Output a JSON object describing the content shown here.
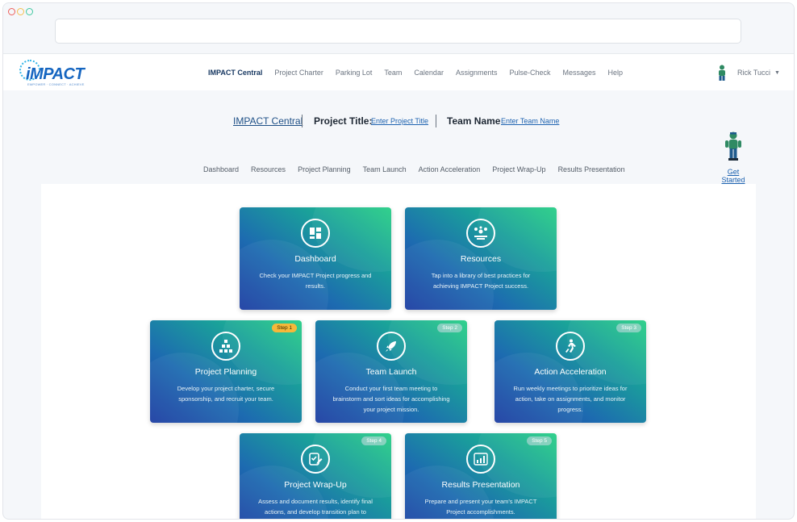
{
  "nav": {
    "logo": "iMPACT",
    "logo_tag": "EMPOWER · CONNECT · ACHIEVE",
    "links": [
      "IMPACT Central",
      "Project Charter",
      "Parking Lot",
      "Team",
      "Calendar",
      "Assignments",
      "Pulse-Check",
      "Messages",
      "Help"
    ],
    "user": "Rick Tucci"
  },
  "titlebar": {
    "central": "IMPACT Central",
    "project_label": "Project Title:",
    "project_link": "Enter Project Title",
    "team_label": "Team Name",
    "team_link": "Enter Team Name"
  },
  "get_started": "Get Started",
  "subnav": [
    "Dashboard",
    "Resources",
    "Project Planning",
    "Team Launch",
    "Action Acceleration",
    "Project Wrap-Up",
    "Results Presentation"
  ],
  "cards": [
    {
      "title": "Dashboard",
      "desc": "Check your IMPACT Project progress and results.",
      "step": "",
      "icon": "dashboard-icon"
    },
    {
      "title": "Resources",
      "desc": "Tap into a library of best practices for achieving IMPACT Project success.",
      "step": "",
      "icon": "resources-icon"
    },
    {
      "title": "Project Planning",
      "desc": "Develop your project charter, secure sponsorship, and recruit your team.",
      "step": "Step 1",
      "icon": "hierarchy-icon"
    },
    {
      "title": "Team Launch",
      "desc": "Conduct your first team meeting to brainstorm and sort ideas for accomplishing your project mission.",
      "step": "Step 2",
      "icon": "rocket-icon"
    },
    {
      "title": "Action Acceleration",
      "desc": "Run weekly meetings to prioritize ideas for action, take on assignments, and monitor progress.",
      "step": "Step 3",
      "icon": "running-person-icon"
    },
    {
      "title": "Project Wrap-Up",
      "desc": "Assess and document results, identify final actions, and develop transition plan to",
      "step": "Step 4",
      "icon": "edit-checklist-icon"
    },
    {
      "title": "Results Presentation",
      "desc": "Prepare and present your team's IMPACT Project accomplishments.",
      "step": "Step 5",
      "icon": "bar-chart-icon"
    }
  ],
  "colors": {
    "accent": "#1d62b0",
    "gold": "#f5b83a",
    "card_start": "#1d3ea3",
    "card_end": "#27cf86"
  }
}
